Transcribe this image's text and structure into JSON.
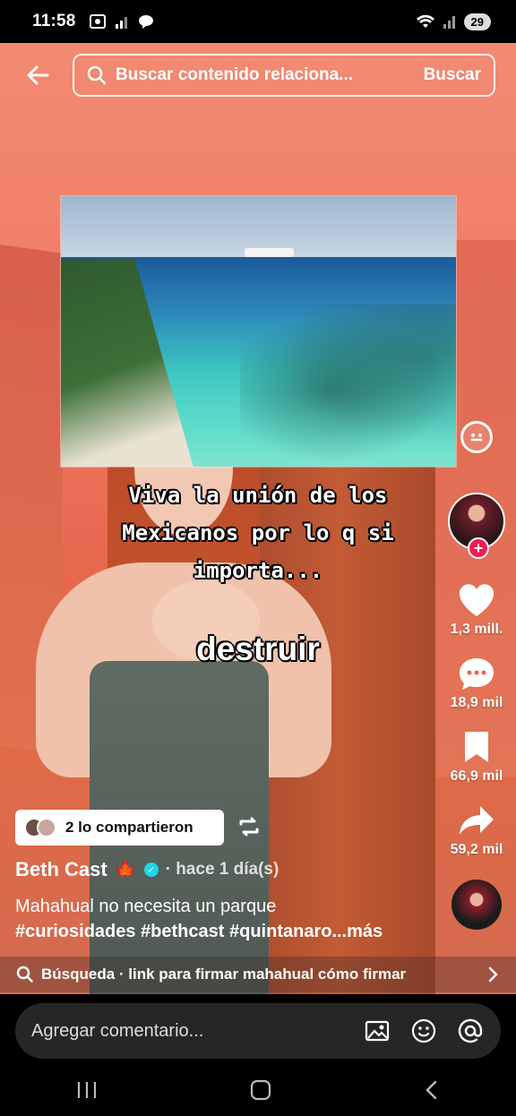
{
  "status": {
    "time": "11:58",
    "battery": "29"
  },
  "search": {
    "query": "Buscar contenido relaciona...",
    "button": "Buscar"
  },
  "video": {
    "caption_lines": [
      "Viva la unión de los",
      "Mexicanos por lo q si",
      "importa..."
    ],
    "overlay_word": "destruir"
  },
  "actions": {
    "likes": "1,3 mill.",
    "comments": "18,9 mil",
    "saves": "66,9 mil",
    "shares": "59,2 mil"
  },
  "shared": {
    "label": "2 lo compartieron"
  },
  "post": {
    "author": "Beth Cast",
    "author_emoji": "🍁",
    "time_ago": "· hace 1 día(s)",
    "description": "Mahahual no necesita un parque",
    "hashtags": "#curiosidades #bethcast #quintanaro...más"
  },
  "related_search": {
    "label": "Búsqueda · link para firmar mahahual cómo firmar"
  },
  "comment": {
    "placeholder": "Agregar comentario..."
  },
  "colors": {
    "accent": "#ee1d52",
    "verified": "#20d5ec"
  }
}
